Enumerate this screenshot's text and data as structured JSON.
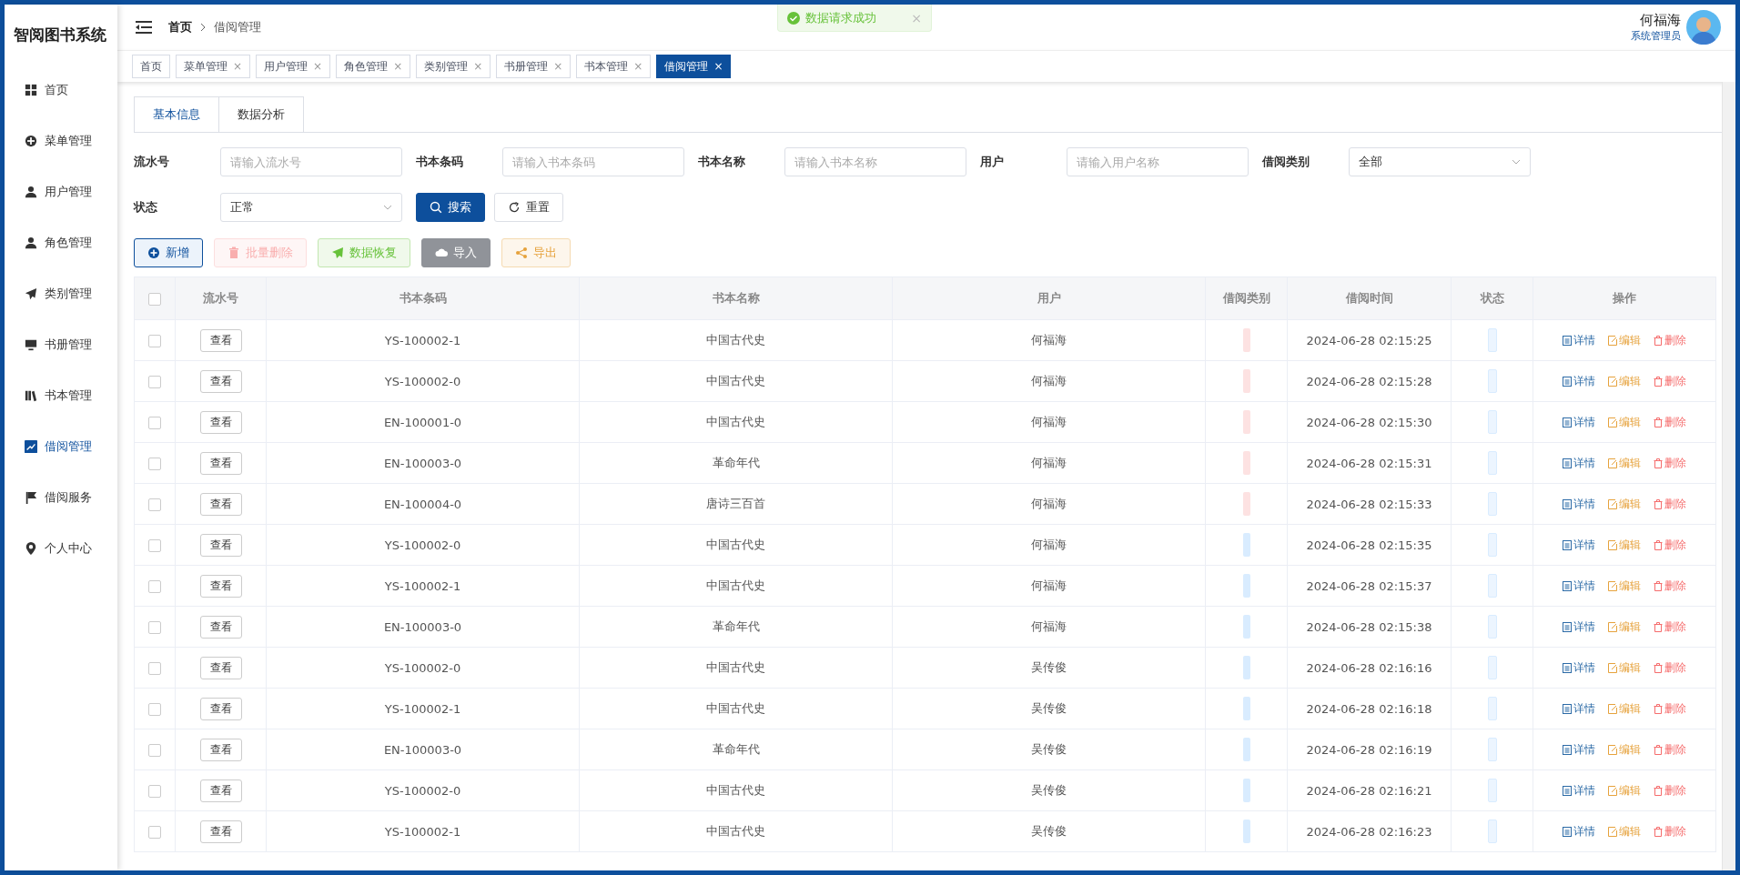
{
  "app_title": "智阅图书系统",
  "sidebar": {
    "items": [
      {
        "label": "首页",
        "selected": false
      },
      {
        "label": "菜单管理",
        "selected": false
      },
      {
        "label": "用户管理",
        "selected": false
      },
      {
        "label": "角色管理",
        "selected": false
      },
      {
        "label": "类别管理",
        "selected": false
      },
      {
        "label": "书册管理",
        "selected": false
      },
      {
        "label": "书本管理",
        "selected": false
      },
      {
        "label": "借阅管理",
        "selected": true
      },
      {
        "label": "借阅服务",
        "selected": false
      },
      {
        "label": "个人中心",
        "selected": false
      }
    ]
  },
  "breadcrumb": [
    "首页",
    "借阅管理"
  ],
  "toast": {
    "text": "数据请求成功",
    "close": "×"
  },
  "user": {
    "name": "何福海",
    "role": "系统管理员"
  },
  "page_tabs": [
    {
      "label": "首页",
      "selected": false,
      "closable": false
    },
    {
      "label": "菜单管理",
      "selected": false,
      "closable": true
    },
    {
      "label": "用户管理",
      "selected": false,
      "closable": true
    },
    {
      "label": "角色管理",
      "selected": false,
      "closable": true
    },
    {
      "label": "类别管理",
      "selected": false,
      "closable": true
    },
    {
      "label": "书册管理",
      "selected": false,
      "closable": true
    },
    {
      "label": "书本管理",
      "selected": false,
      "closable": true
    },
    {
      "label": "借阅管理",
      "selected": true,
      "closable": true
    }
  ],
  "tab_close": "×",
  "content_tabs": [
    {
      "label": "基本信息",
      "selected": true
    },
    {
      "label": "数据分析",
      "selected": false
    }
  ],
  "filters": [
    {
      "label": "流水号",
      "kind": "input",
      "placeholder": "请输入流水号"
    },
    {
      "label": "书本条码",
      "kind": "input",
      "placeholder": "请输入书本条码"
    },
    {
      "label": "书本名称",
      "kind": "input",
      "placeholder": "请输入书本名称"
    },
    {
      "label": "用户",
      "kind": "input",
      "placeholder": "请输入用户名称"
    },
    {
      "label": "借阅类别",
      "kind": "select",
      "value": "全部"
    },
    {
      "label": "状态",
      "kind": "select",
      "value": "正常"
    }
  ],
  "search_button": "搜索",
  "reset_button": "重置",
  "actions": [
    {
      "label": "新增",
      "kind": "primary",
      "disabled": false
    },
    {
      "label": "批量删除",
      "kind": "danger",
      "disabled": true
    },
    {
      "label": "数据恢复",
      "kind": "success",
      "disabled": false
    },
    {
      "label": "导入",
      "kind": "info",
      "disabled": false
    },
    {
      "label": "导出",
      "kind": "warning",
      "disabled": false
    }
  ],
  "table": {
    "select_all_checked": false,
    "columns": [
      "流水号",
      "书本条码",
      "书本名称",
      "用户",
      "借阅类别",
      "借阅时间",
      "状态",
      "操作"
    ],
    "rows": [
      {
        "checked": false,
        "view": "查看",
        "barcode": "YS-100002-1",
        "book": "中国古代史",
        "user": "何福海",
        "category_tag": {
          "color": "#fde2e2"
        },
        "time": "2024-06-28 02:15:25",
        "actions": [
          "详情",
          "编辑",
          "删除"
        ]
      },
      {
        "checked": false,
        "view": "查看",
        "barcode": "YS-100002-0",
        "book": "中国古代史",
        "user": "何福海",
        "category_tag": {
          "color": "#fde2e2"
        },
        "time": "2024-06-28 02:15:28",
        "actions": [
          "详情",
          "编辑",
          "删除"
        ]
      },
      {
        "checked": false,
        "view": "查看",
        "barcode": "EN-100001-0",
        "book": "中国古代史",
        "user": "何福海",
        "category_tag": {
          "color": "#fde2e2"
        },
        "time": "2024-06-28 02:15:30",
        "actions": [
          "详情",
          "编辑",
          "删除"
        ]
      },
      {
        "checked": false,
        "view": "查看",
        "barcode": "EN-100003-0",
        "book": "革命年代",
        "user": "何福海",
        "category_tag": {
          "color": "#fde2e2"
        },
        "time": "2024-06-28 02:15:31",
        "actions": [
          "详情",
          "编辑",
          "删除"
        ]
      },
      {
        "checked": false,
        "view": "查看",
        "barcode": "EN-100004-0",
        "book": "唐诗三百首",
        "user": "何福海",
        "category_tag": {
          "color": "#fde2e2"
        },
        "time": "2024-06-28 02:15:33",
        "actions": [
          "详情",
          "编辑",
          "删除"
        ]
      },
      {
        "checked": false,
        "view": "查看",
        "barcode": "YS-100002-0",
        "book": "中国古代史",
        "user": "何福海",
        "category_tag": {
          "color": "#d9ecff"
        },
        "time": "2024-06-28 02:15:35",
        "actions": [
          "详情",
          "编辑",
          "删除"
        ]
      },
      {
        "checked": false,
        "view": "查看",
        "barcode": "YS-100002-1",
        "book": "中国古代史",
        "user": "何福海",
        "category_tag": {
          "color": "#d9ecff"
        },
        "time": "2024-06-28 02:15:37",
        "actions": [
          "详情",
          "编辑",
          "删除"
        ]
      },
      {
        "checked": false,
        "view": "查看",
        "barcode": "EN-100003-0",
        "book": "革命年代",
        "user": "何福海",
        "category_tag": {
          "color": "#d9ecff"
        },
        "time": "2024-06-28 02:15:38",
        "actions": [
          "详情",
          "编辑",
          "删除"
        ]
      },
      {
        "checked": false,
        "view": "查看",
        "barcode": "YS-100002-0",
        "book": "中国古代史",
        "user": "吴传俊",
        "category_tag": {
          "color": "#d9ecff"
        },
        "time": "2024-06-28 02:16:16",
        "actions": [
          "详情",
          "编辑",
          "删除"
        ]
      },
      {
        "checked": false,
        "view": "查看",
        "barcode": "YS-100002-1",
        "book": "中国古代史",
        "user": "吴传俊",
        "category_tag": {
          "color": "#d9ecff"
        },
        "time": "2024-06-28 02:16:18",
        "actions": [
          "详情",
          "编辑",
          "删除"
        ]
      },
      {
        "checked": false,
        "view": "查看",
        "barcode": "EN-100003-0",
        "book": "革命年代",
        "user": "吴传俊",
        "category_tag": {
          "color": "#d9ecff"
        },
        "time": "2024-06-28 02:16:19",
        "actions": [
          "详情",
          "编辑",
          "删除"
        ]
      },
      {
        "checked": false,
        "view": "查看",
        "barcode": "YS-100002-0",
        "book": "中国古代史",
        "user": "吴传俊",
        "category_tag": {
          "color": "#d9ecff"
        },
        "time": "2024-06-28 02:16:21",
        "actions": [
          "详情",
          "编辑",
          "删除"
        ]
      },
      {
        "checked": false,
        "view": "查看",
        "barcode": "YS-100002-1",
        "book": "中国古代史",
        "user": "吴传俊",
        "category_tag": {
          "color": "#d9ecff"
        },
        "time": "2024-06-28 02:16:23",
        "actions": [
          "详情",
          "编辑",
          "删除"
        ]
      }
    ]
  }
}
